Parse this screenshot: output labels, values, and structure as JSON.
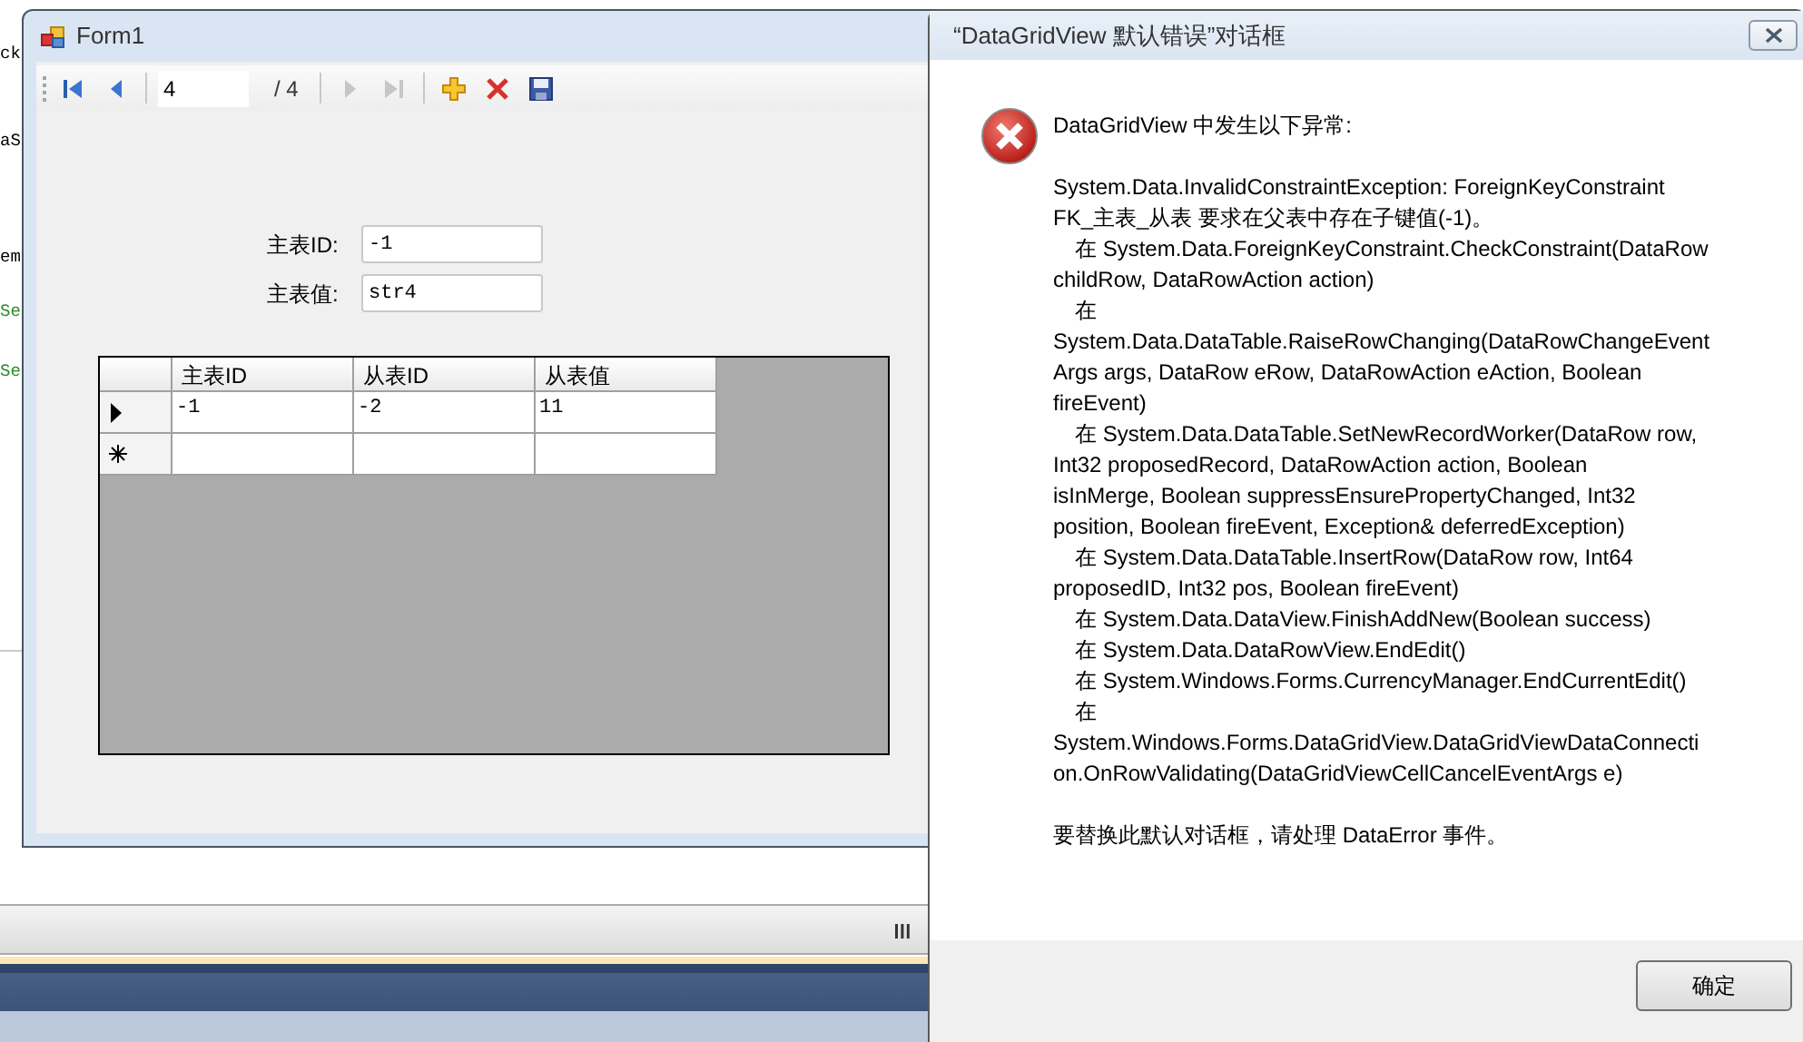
{
  "background_code": [
    "ck",
    "aS",
    "em",
    "Se",
    "Se"
  ],
  "form_window": {
    "title": "Form1",
    "toolbar": [
      {
        "kind": "grip"
      },
      {
        "kind": "first",
        "disabled": false
      },
      {
        "kind": "prev",
        "disabled": false
      },
      {
        "kind": "sep"
      },
      {
        "kind": "position",
        "value": "4"
      },
      {
        "kind": "count",
        "text": "/ 4"
      },
      {
        "kind": "sep"
      },
      {
        "kind": "next",
        "disabled": true
      },
      {
        "kind": "last",
        "disabled": true
      },
      {
        "kind": "sep"
      },
      {
        "kind": "add",
        "disabled": false
      },
      {
        "kind": "delete",
        "disabled": false
      },
      {
        "kind": "save",
        "disabled": false
      }
    ],
    "fields": [
      {
        "label": "主表ID:",
        "value": "-1"
      },
      {
        "label": "主表值:",
        "value": "str4"
      }
    ],
    "grid": {
      "columns": [
        "主表ID",
        "从表ID",
        "从表值"
      ],
      "rows": [
        {
          "kind": "current",
          "cells": [
            "-1",
            "-2",
            "11"
          ]
        },
        {
          "kind": "new",
          "cells": []
        }
      ]
    }
  },
  "dialog": {
    "title": "“DataGridView 默认错误”对话框",
    "heading": "DataGridView 中发生以下异常:",
    "lines": [
      {
        "text": "System.Data.InvalidConstraintException: ForeignKeyConstraint",
        "indent": false
      },
      {
        "text": "FK_主表_从表 要求在父表中存在子键值(-1)。",
        "indent": false
      },
      {
        "text": "在 System.Data.ForeignKeyConstraint.CheckConstraint(DataRow",
        "indent": true
      },
      {
        "text": "childRow, DataRowAction action)",
        "indent": false
      },
      {
        "text": "在",
        "indent": true
      },
      {
        "text": "System.Data.DataTable.RaiseRowChanging(DataRowChangeEvent",
        "indent": false
      },
      {
        "text": "Args args, DataRow eRow, DataRowAction eAction, Boolean",
        "indent": false
      },
      {
        "text": "fireEvent)",
        "indent": false
      },
      {
        "text": "在 System.Data.DataTable.SetNewRecordWorker(DataRow row,",
        "indent": true
      },
      {
        "text": "Int32 proposedRecord, DataRowAction action, Boolean",
        "indent": false
      },
      {
        "text": "isInMerge, Boolean suppressEnsurePropertyChanged, Int32",
        "indent": false
      },
      {
        "text": "position, Boolean fireEvent, Exception& deferredException)",
        "indent": false
      },
      {
        "text": "在 System.Data.DataTable.InsertRow(DataRow row, Int64",
        "indent": true
      },
      {
        "text": "proposedID, Int32 pos, Boolean fireEvent)",
        "indent": false
      },
      {
        "text": "在 System.Data.DataView.FinishAddNew(Boolean success)",
        "indent": true
      },
      {
        "text": "在 System.Data.DataRowView.EndEdit()",
        "indent": true
      },
      {
        "text": "在 System.Windows.Forms.CurrencyManager.EndCurrentEdit()",
        "indent": true
      },
      {
        "text": "在",
        "indent": true
      },
      {
        "text": "System.Windows.Forms.DataGridView.DataGridViewDataConnecti",
        "indent": false
      },
      {
        "text": "on.OnRowValidating(DataGridViewCellCancelEventArgs e)",
        "indent": false
      }
    ],
    "footer_note": "要替换此默认对话框，请处理 DataError 事件。",
    "ok_button": "确定"
  }
}
